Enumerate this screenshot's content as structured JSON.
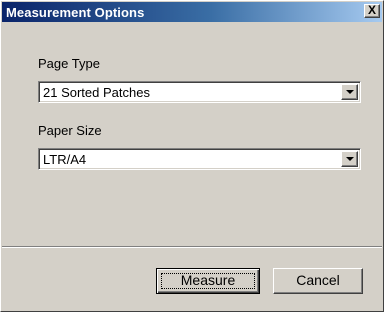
{
  "dialog": {
    "title": "Measurement Options",
    "close_glyph": "X"
  },
  "page_type": {
    "label": "Page Type",
    "value": "21 Sorted Patches"
  },
  "paper_size": {
    "label": "Paper Size",
    "value": "LTR/A4"
  },
  "buttons": {
    "measure": "Measure",
    "cancel": "Cancel"
  },
  "icons": {
    "close": "close-icon",
    "dropdown": "chevron-down-icon"
  },
  "colors": {
    "title_bar_start": "#0a246a",
    "title_bar_end": "#a6caf0",
    "dialog_face": "#d4d0c8"
  }
}
